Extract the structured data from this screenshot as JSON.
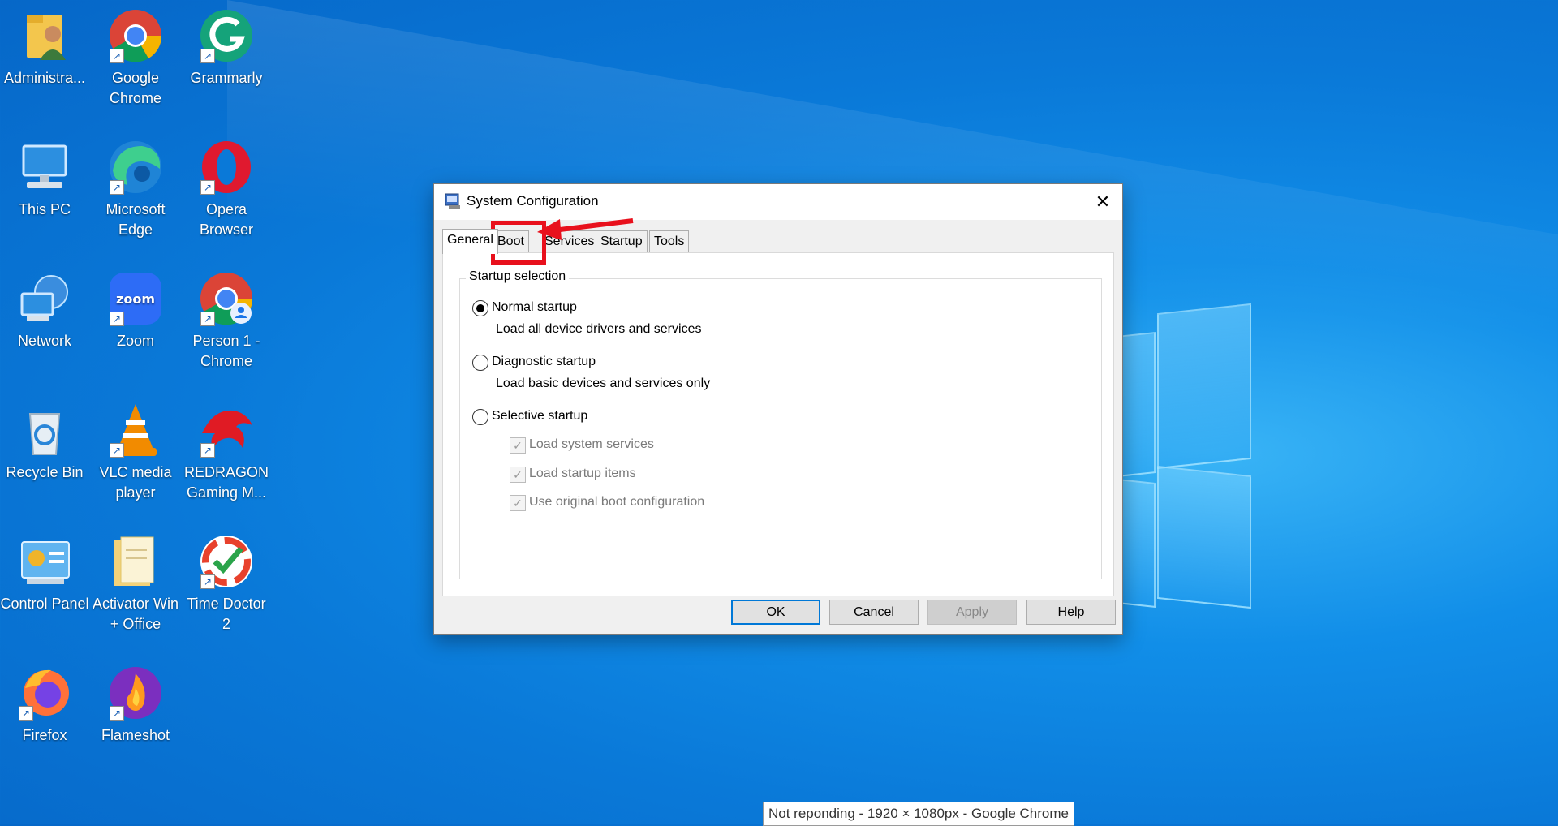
{
  "desktop": {
    "icons": [
      {
        "label": "Administra...",
        "icon": "user-folder-icon"
      },
      {
        "label": "Google Chrome",
        "icon": "chrome-icon"
      },
      {
        "label": "Grammarly",
        "icon": "grammarly-icon"
      },
      {
        "label": "This PC",
        "icon": "computer-icon"
      },
      {
        "label": "Microsoft Edge",
        "icon": "edge-icon"
      },
      {
        "label": "Opera Browser",
        "icon": "opera-icon"
      },
      {
        "label": "Network",
        "icon": "network-icon"
      },
      {
        "label": "Zoom",
        "icon": "zoom-icon"
      },
      {
        "label": "Person 1 - Chrome",
        "icon": "chrome-profile-icon"
      },
      {
        "label": "Recycle Bin",
        "icon": "recycle-bin-icon"
      },
      {
        "label": "VLC media player",
        "icon": "vlc-icon"
      },
      {
        "label": "REDRAGON Gaming M...",
        "icon": "redragon-icon"
      },
      {
        "label": "Control Panel",
        "icon": "control-panel-icon"
      },
      {
        "label": "Activator Win + Office",
        "icon": "folder-icon"
      },
      {
        "label": "Time Doctor 2",
        "icon": "time-doctor-icon"
      },
      {
        "label": "Firefox",
        "icon": "firefox-icon"
      },
      {
        "label": "Flameshot",
        "icon": "flameshot-icon"
      }
    ],
    "zoom_text": "zoom"
  },
  "dialog": {
    "title": "System Configuration",
    "close_glyph": "✕",
    "tabs": [
      "General",
      "Boot",
      "Services",
      "Startup",
      "Tools"
    ],
    "active_tab": "General",
    "group_label": "Startup selection",
    "options": [
      {
        "label": "Normal startup",
        "description": "Load all device drivers and services",
        "selected": true
      },
      {
        "label": "Diagnostic startup",
        "description": "Load basic devices and services only",
        "selected": false
      },
      {
        "label": "Selective startup",
        "description": "",
        "selected": false
      }
    ],
    "checkboxes": [
      {
        "label": "Load system services",
        "checked": true,
        "enabled": false
      },
      {
        "label": "Load startup items",
        "checked": true,
        "enabled": false
      },
      {
        "label": "Use original boot configuration",
        "checked": true,
        "enabled": false
      }
    ],
    "buttons": {
      "ok": "OK",
      "cancel": "Cancel",
      "apply": "Apply",
      "help": "Help"
    },
    "check_glyph": "✓"
  },
  "tooltip": "Not reponding - 1920 × 1080px - Google Chrome",
  "colors": {
    "highlight": "#e8101c",
    "accent": "#0078d7"
  }
}
